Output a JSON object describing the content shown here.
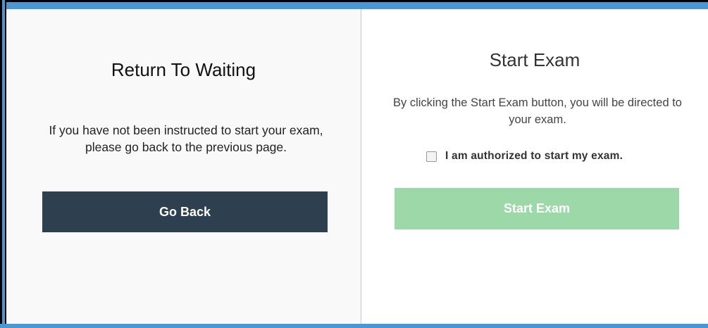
{
  "left_panel": {
    "title": "Return To Waiting",
    "description": "If you have not been instructed to start your exam, please go back to the previous page.",
    "button_label": "Go Back"
  },
  "right_panel": {
    "title": "Start Exam",
    "description": "By clicking the Start Exam button, you will be directed to your exam.",
    "checkbox_label": "I am authorized to start my exam.",
    "checkbox_checked": false,
    "button_label": "Start Exam",
    "button_enabled": false
  },
  "colors": {
    "frame_blue": "#4a98d3",
    "go_back_bg": "#2e3f50",
    "start_disabled_bg": "#9dd9a8"
  }
}
